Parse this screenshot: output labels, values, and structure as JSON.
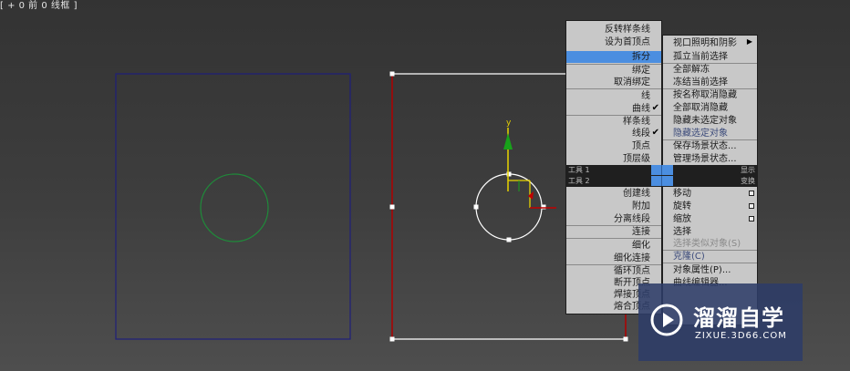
{
  "viewport": {
    "label": "[ + 0 前 0 线框 ]"
  },
  "colors": {
    "menu_bg": "#c8c8c8",
    "menu_highlight": "#4b8ee0",
    "square_outline": "#1f1f7a",
    "green_circle": "#1f8a3a",
    "spline_red": "#b00000"
  },
  "gizmo": {
    "y_label": "y"
  },
  "left_menu": {
    "items": [
      {
        "label": "反转样条线"
      },
      {
        "label": "设为首顶点"
      },
      {
        "label": "拆分",
        "selected": true
      },
      {
        "label": "绑定"
      },
      {
        "label": "取消绑定"
      },
      {
        "label": "线"
      },
      {
        "label": "曲线",
        "checked": true
      },
      {
        "label": "样条线"
      },
      {
        "label": "线段",
        "checked": true
      },
      {
        "label": "顶点"
      },
      {
        "label": "顶层级"
      }
    ],
    "tools_items": [
      {
        "label": "创建线"
      },
      {
        "label": "附加"
      },
      {
        "label": "分离线段"
      },
      {
        "label": "连接"
      },
      {
        "label": "细化"
      },
      {
        "label": "细化连接"
      },
      {
        "label": "循环顶点"
      },
      {
        "label": "断开顶点"
      },
      {
        "label": "焊接顶点"
      },
      {
        "label": "熔合顶点"
      }
    ]
  },
  "right_menu": {
    "items": [
      {
        "label": "视口照明和阴影",
        "submenu": true
      },
      {
        "label": "孤立当前选择"
      },
      {
        "label": "全部解冻"
      },
      {
        "label": "冻结当前选择"
      },
      {
        "label": "按名称取消隐藏"
      },
      {
        "label": "全部取消隐藏"
      },
      {
        "label": "隐藏未选定对象"
      },
      {
        "label": "隐藏选定对象"
      },
      {
        "label": "保存场景状态..."
      },
      {
        "label": "管理场景状态..."
      }
    ],
    "transform_items": [
      {
        "label": "移动"
      },
      {
        "label": "旋转"
      },
      {
        "label": "缩放"
      },
      {
        "label": "选择"
      },
      {
        "label": "选择类似对象(S)"
      },
      {
        "label": "克隆(C)"
      },
      {
        "label": "对象属性(P)..."
      },
      {
        "label": "曲线编辑器..."
      }
    ]
  },
  "quad_titles": {
    "tools1": "工具 1",
    "tools2": "工具 2",
    "display": "显示",
    "transform": "变换"
  },
  "watermark": {
    "title": "溜溜自学",
    "url": "ZIXUE.3D66.COM"
  }
}
